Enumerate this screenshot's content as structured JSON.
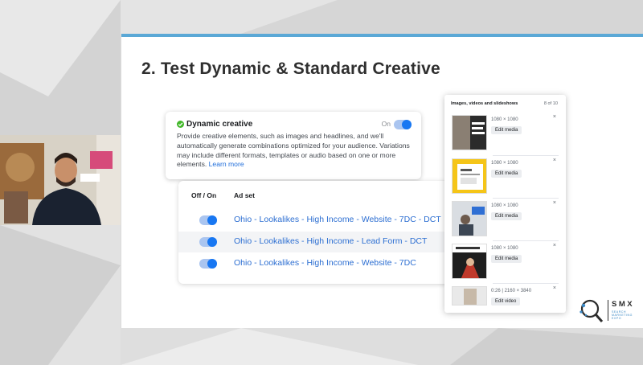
{
  "slide": {
    "title": "2. Test Dynamic & Standard Creative"
  },
  "dynamic_creative": {
    "title": "Dynamic creative",
    "toggle_label": "On",
    "toggle_on": true,
    "description": "Provide creative elements, such as images and headlines, and we'll automatically generate combinations optimized for your audience. Variations may include different formats, templates or audio based on one or more elements.",
    "learn_more": "Learn more"
  },
  "adset_table": {
    "col_toggle": "Off / On",
    "col_adset": "Ad set",
    "rows": [
      {
        "name": "Ohio - Lookalikes - High Income - Website - 7DC - DCT",
        "on": true
      },
      {
        "name": "Ohio - Lookalikes - High Income - Lead Form - DCT",
        "on": true
      },
      {
        "name": "Ohio - Lookalikes - High Income - Website - 7DC",
        "on": true
      }
    ]
  },
  "media_panel": {
    "title": "Images, videos and slideshows",
    "count": "8 of 10",
    "items": [
      {
        "dims": "1080 × 1080",
        "action": "Edit media"
      },
      {
        "dims": "1080 × 1080",
        "action": "Edit media"
      },
      {
        "dims": "1080 × 1080",
        "action": "Edit media"
      },
      {
        "dims": "1080 × 1080",
        "action": "Edit media"
      },
      {
        "dims": "0:26 | 2160 × 3840",
        "action": "Edit video"
      }
    ],
    "close_glyph": "×"
  },
  "logo": {
    "brand": "SMX",
    "tagline": "SEARCH MARKETING EXPO"
  },
  "colors": {
    "accent": "#5aa8d6",
    "link": "#2d6fd2",
    "toggle": "#1877f2"
  }
}
